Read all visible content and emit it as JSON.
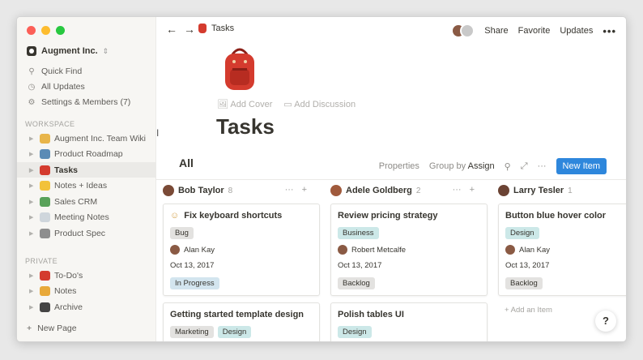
{
  "window": {
    "traffic_colors": [
      "#fc5f57",
      "#fdbc2e",
      "#28c840"
    ]
  },
  "sidebar": {
    "workspace_name": "Augment Inc.",
    "quick_find": "Quick Find",
    "all_updates": "All Updates",
    "settings": "Settings & Members (7)",
    "workspace_label": "WORKSPACE",
    "workspace_pages": [
      {
        "label": "Augment Inc. Team Wiki",
        "icon": "people-icon",
        "color": "#e8b54a"
      },
      {
        "label": "Product Roadmap",
        "icon": "map-icon",
        "color": "#5b8bb5"
      },
      {
        "label": "Tasks",
        "icon": "backpack-icon",
        "color": "#d43b2e",
        "active": true
      },
      {
        "label": "Notes + Ideas",
        "icon": "grin-icon",
        "color": "#f2c23a"
      },
      {
        "label": "Sales CRM",
        "icon": "money-icon",
        "color": "#59a25a"
      },
      {
        "label": "Meeting Notes",
        "icon": "speech-bubble-icon",
        "color": "#cfd6dc"
      },
      {
        "label": "Product Spec",
        "icon": "wrench-icon",
        "color": "#8e8e8e"
      }
    ],
    "private_label": "PRIVATE",
    "private_pages": [
      {
        "label": "To-Do's",
        "icon": "flag-icon",
        "color": "#d43b2e"
      },
      {
        "label": "Notes",
        "icon": "pencil-icon",
        "color": "#e8a93a"
      },
      {
        "label": "Archive",
        "icon": "box-icon",
        "color": "#444444"
      }
    ],
    "new_page": "New Page"
  },
  "topbar": {
    "breadcrumb": "Tasks",
    "share": "Share",
    "favorite": "Favorite",
    "updates": "Updates"
  },
  "page": {
    "add_cover": "Add Cover",
    "add_discussion": "Add Discussion",
    "title": "Tasks",
    "view_name": "All",
    "properties": "Properties",
    "group_by_label": "Group by",
    "group_by_value": "Assign",
    "new_item": "New Item"
  },
  "board": {
    "columns": [
      {
        "name": "Bob Taylor",
        "count": "8",
        "cards": [
          {
            "title": "Fix keyboard shortcuts",
            "tags": [
              {
                "label": "Bug",
                "color": "#e3e2e0"
              }
            ],
            "person": "Alan Kay",
            "date": "Oct 13, 2017",
            "status": {
              "label": "In Progress",
              "color": "#d3e5ef"
            }
          },
          {
            "title": "Getting started template design",
            "tags": [
              {
                "label": "Marketing",
                "color": "#e3e2e0"
              },
              {
                "label": "Design",
                "color": "#cce8e8"
              }
            ]
          }
        ]
      },
      {
        "name": "Adele Goldberg",
        "count": "2",
        "cards": [
          {
            "title": "Review pricing strategy",
            "tags": [
              {
                "label": "Business",
                "color": "#cce8e8"
              }
            ],
            "person": "Robert Metcalfe",
            "date": "Oct 13, 2017",
            "status": {
              "label": "Backlog",
              "color": "#e3e2e0"
            }
          },
          {
            "title": "Polish tables UI",
            "tags": [
              {
                "label": "Design",
                "color": "#cce8e8"
              }
            ]
          }
        ]
      },
      {
        "name": "Larry Tesler",
        "count": "1",
        "cards": [
          {
            "title": "Button blue hover color",
            "tags": [
              {
                "label": "Design",
                "color": "#cce8e8"
              }
            ],
            "person": "Alan Kay",
            "date": "Oct 13, 2017",
            "status": {
              "label": "Backlog",
              "color": "#e3e2e0"
            }
          }
        ],
        "add_item": "+ Add an Item"
      }
    ]
  },
  "help": "?"
}
